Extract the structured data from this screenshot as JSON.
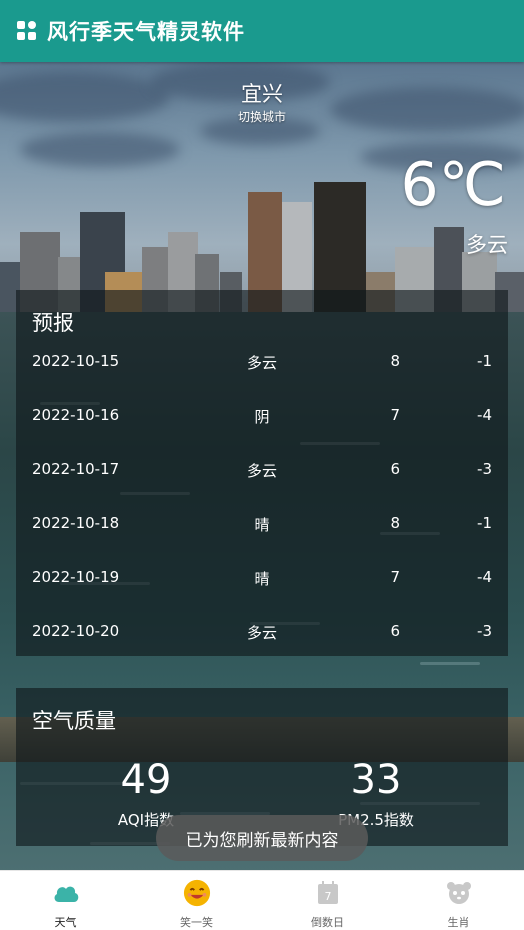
{
  "app": {
    "title": "风行季天气精灵软件"
  },
  "location": {
    "city": "宜兴",
    "switch_label": "切换城市"
  },
  "current": {
    "temperature": "6℃",
    "condition": "多云"
  },
  "forecast": {
    "title": "预报",
    "rows": [
      {
        "date": "2022-10-15",
        "condition": "多云",
        "high": "8",
        "low": "-1"
      },
      {
        "date": "2022-10-16",
        "condition": "阴",
        "high": "7",
        "low": "-4"
      },
      {
        "date": "2022-10-17",
        "condition": "多云",
        "high": "6",
        "low": "-3"
      },
      {
        "date": "2022-10-18",
        "condition": "晴",
        "high": "8",
        "low": "-1"
      },
      {
        "date": "2022-10-19",
        "condition": "晴",
        "high": "7",
        "low": "-4"
      },
      {
        "date": "2022-10-20",
        "condition": "多云",
        "high": "6",
        "low": "-3"
      }
    ]
  },
  "air_quality": {
    "title": "空气质量",
    "aqi_value": "49",
    "aqi_label": "AQI指数",
    "pm25_value": "33",
    "pm25_label": "PM2.5指数"
  },
  "toast": {
    "text": "已为您刷新最新内容"
  },
  "bottom_nav": {
    "items": [
      {
        "label": "天气",
        "icon": "cloud-icon",
        "active": true
      },
      {
        "label": "笑一笑",
        "icon": "smiley-icon",
        "active": false
      },
      {
        "label": "倒数日",
        "icon": "calendar-icon",
        "active": false
      },
      {
        "label": "生肖",
        "icon": "zodiac-icon",
        "active": false
      }
    ]
  },
  "colors": {
    "app_bar": "#1a9a8e",
    "active_icon": "#3bb3a8",
    "smiley": "#f5b301",
    "inactive_icon": "#c8c8c8"
  }
}
